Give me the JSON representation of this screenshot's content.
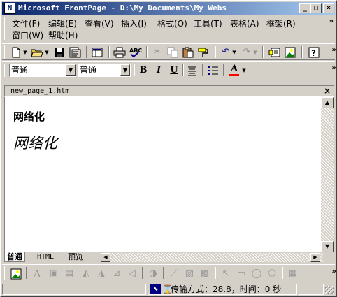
{
  "window": {
    "title": "Microsoft FrontPage - D:\\My Documents\\My Webs",
    "min_glyph": "_",
    "max_glyph": "□",
    "close_glyph": "×"
  },
  "menu": {
    "items": [
      "文件(F)",
      "编辑(E)",
      "查看(V)",
      "插入(I)",
      "格式(O)",
      "工具(T)",
      "表格(A)",
      "框架(R)",
      "窗口(W)",
      "帮助(H)"
    ],
    "more": "»"
  },
  "format_toolbar": {
    "style_value": "普通",
    "font_value": "普通",
    "bold": "B",
    "italic": "I",
    "underline": "U",
    "font_color_letter": "A",
    "more": "»"
  },
  "document": {
    "tab_name": "new_page_1.htm",
    "close_glyph": "×",
    "heading_bold": "网络化",
    "heading_italic": "网络化"
  },
  "view_tabs": [
    "普通",
    "HTML",
    "预览"
  ],
  "status": {
    "transfer_text": "传输方式：28.8，时间：0 秒"
  },
  "colors": {
    "title_start": "#0a246a",
    "title_end": "#a6caf0",
    "face": "#d4d0c8",
    "font_color_bar": "#ff0000"
  }
}
